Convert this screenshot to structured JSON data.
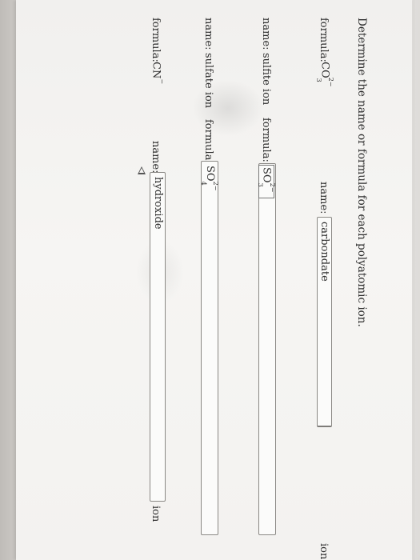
{
  "question": {
    "title": "Determine the name or formula for each polyatomic ion."
  },
  "rows": [
    {
      "given_label": "formula:",
      "given_formula": {
        "base": "CO",
        "subscript": "3",
        "charge": "2−"
      },
      "answer_label": "name:",
      "answer_value": "carbondate",
      "suffix": "ion"
    },
    {
      "given_label": "name:",
      "given_name": "sulfite ion",
      "answer_label": "formula:",
      "answer_formula": {
        "base": "SO",
        "subscript": "3",
        "charge": "2−"
      }
    },
    {
      "given_label": "name:",
      "given_name": "sulfate ion",
      "answer_label": "formula:",
      "answer_formula": {
        "base": "SO",
        "subscript": "4",
        "charge": "2−"
      }
    },
    {
      "given_label": "formula:",
      "given_formula": {
        "base": "CN",
        "charge": "−"
      },
      "answer_label": "name:",
      "answer_value": "hydroxide",
      "suffix": "ion"
    }
  ],
  "icons": {
    "cursor": "mouse-pointer-icon"
  }
}
